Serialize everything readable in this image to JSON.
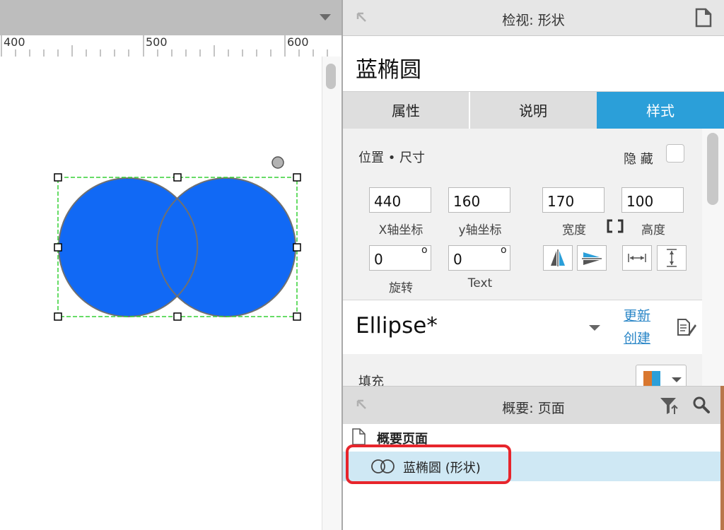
{
  "ruler": {
    "labels": [
      "400",
      "500",
      "600"
    ]
  },
  "canvas": {
    "shape_fill": "#1169f5",
    "shape_stroke": "#707070",
    "selection_color": "#35d135"
  },
  "inspector": {
    "header_title": "检视: 形状",
    "shape_name": "蓝椭圆",
    "tabs": [
      "属性",
      "说明",
      "样式"
    ],
    "active_tab": "样式",
    "accent": "#2b9fd9"
  },
  "geometry": {
    "section_title": "位置 • 尺寸",
    "hidden_label": "隐 藏",
    "x_value": "440",
    "x_label": "X轴坐标",
    "y_value": "160",
    "y_label": "y轴坐标",
    "width_value": "170",
    "width_label": "宽度",
    "height_value": "100",
    "height_label": "高度",
    "rotation_value": "0",
    "rotation_label": "旋转",
    "text_rotation_value": "0",
    "text_rotation_label": "Text",
    "degree_symbol": "o"
  },
  "style": {
    "name": "Ellipse*",
    "update_link": "更新",
    "create_link": "创建",
    "fill_label": "填充"
  },
  "outline": {
    "header_title": "概要: 页面",
    "page_item": "概要页面",
    "shape_item": "蓝椭圆 (形状)",
    "highlight_color": "#e7252c"
  }
}
